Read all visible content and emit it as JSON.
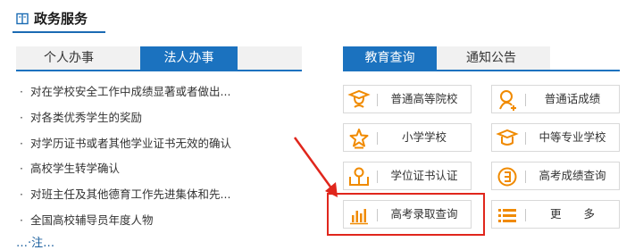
{
  "header": {
    "title": "政务服务",
    "icon": "book-icon"
  },
  "left_tabs": {
    "items": [
      {
        "label": "个人办事"
      },
      {
        "label": "法人办事"
      }
    ],
    "active": "法人办事"
  },
  "news": {
    "bullet": "·",
    "items": [
      {
        "text": "对在学校安全工作中成绩显著或者做出..."
      },
      {
        "text": "对各类优秀学生的奖励"
      },
      {
        "text": "对学历证书或者其他学业证书无效的确认"
      },
      {
        "text": "高校学生转学确认"
      },
      {
        "text": "对班主任及其他德育工作先进集体和先..."
      },
      {
        "text": "全国高校辅导员年度人物"
      }
    ]
  },
  "right_tabs": {
    "items": [
      {
        "label": "教育查询"
      },
      {
        "label": "通知公告"
      }
    ],
    "active": "教育查询"
  },
  "services": [
    {
      "label": "普通高等院校",
      "icon": "graduation-cap-icon"
    },
    {
      "label": "普通话成绩",
      "icon": "person-speaking-icon"
    },
    {
      "label": "小学学校",
      "icon": "star-badge-icon"
    },
    {
      "label": "中等专业学校",
      "icon": "mortarboard-icon"
    },
    {
      "label": "学位证书认证",
      "icon": "certificate-icon"
    },
    {
      "label": "高考成绩查询",
      "icon": "exam-score-icon"
    },
    {
      "label": "高考录取查询",
      "icon": "bar-chart-icon"
    },
    {
      "label": "更　　多",
      "icon": "list-icon"
    }
  ],
  "annotation": {
    "highlighted": "高考录取查询",
    "color": "#e0261c"
  },
  "colors": {
    "accent": "#1b72bf",
    "icon_orange": "#f08a00"
  },
  "partial_text": "…·注…"
}
